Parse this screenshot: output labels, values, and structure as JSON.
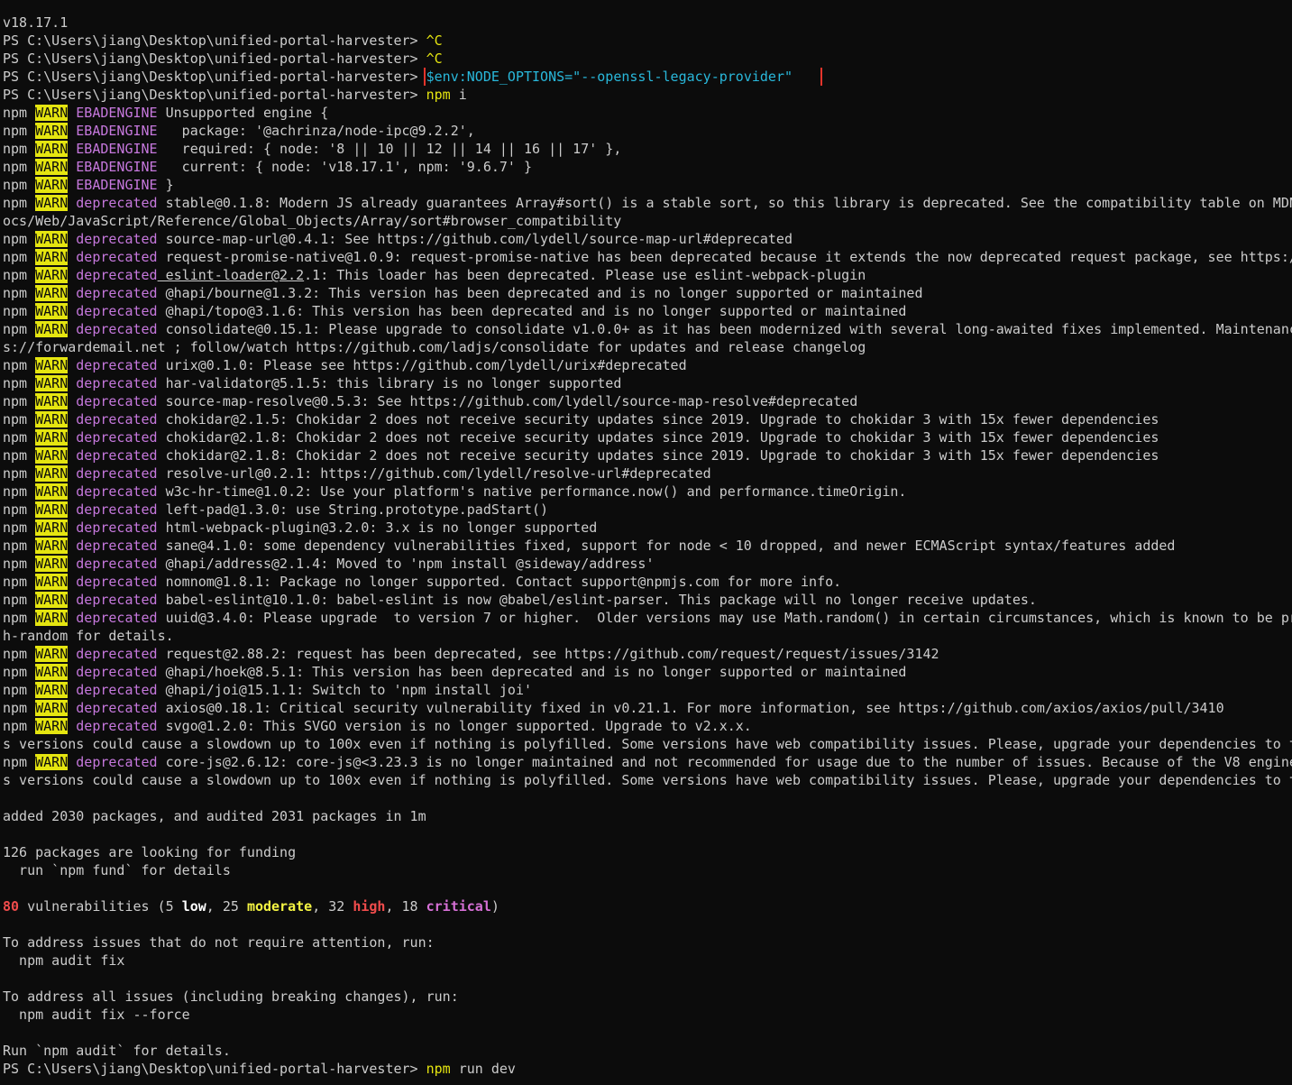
{
  "terminal": {
    "lines": [
      [
        {
          "t": "v18.17.1"
        }
      ],
      [
        {
          "t": "PS C:\\Users\\jiang\\Desktop\\unified-portal-harvester> "
        },
        {
          "t": "^C",
          "c": "yellow"
        }
      ],
      [
        {
          "t": "PS C:\\Users\\jiang\\Desktop\\unified-portal-harvester> "
        },
        {
          "t": "^C",
          "c": "yellow"
        }
      ],
      [
        {
          "t": "PS C:\\Users\\jiang\\Desktop\\unified-portal-harvester> "
        },
        {
          "t": "$env:NODE_OPTIONS=",
          "c": "cyan boxed-start"
        },
        {
          "t": "\"--openssl-legacy-provider\"",
          "c": "cyan boxed-end"
        }
      ],
      [
        {
          "t": "PS C:\\Users\\jiang\\Desktop\\unified-portal-harvester> "
        },
        {
          "t": "npm",
          "c": "yellow"
        },
        {
          "t": " i"
        }
      ],
      [
        {
          "t": "npm "
        },
        {
          "t": "WARN",
          "c": "warn"
        },
        {
          "t": " "
        },
        {
          "t": "EBADENGINE",
          "c": "magenta"
        },
        {
          "t": " Unsupported engine {"
        }
      ],
      [
        {
          "t": "npm "
        },
        {
          "t": "WARN",
          "c": "warn"
        },
        {
          "t": " "
        },
        {
          "t": "EBADENGINE",
          "c": "magenta"
        },
        {
          "t": "   package: '@achrinza/node-ipc@9.2.2',"
        }
      ],
      [
        {
          "t": "npm "
        },
        {
          "t": "WARN",
          "c": "warn"
        },
        {
          "t": " "
        },
        {
          "t": "EBADENGINE",
          "c": "magenta"
        },
        {
          "t": "   required: { node: '8 || 10 || 12 || 14 || 16 || 17' },"
        }
      ],
      [
        {
          "t": "npm "
        },
        {
          "t": "WARN",
          "c": "warn"
        },
        {
          "t": " "
        },
        {
          "t": "EBADENGINE",
          "c": "magenta"
        },
        {
          "t": "   current: { node: 'v18.17.1', npm: '9.6.7' }"
        }
      ],
      [
        {
          "t": "npm "
        },
        {
          "t": "WARN",
          "c": "warn"
        },
        {
          "t": " "
        },
        {
          "t": "EBADENGINE",
          "c": "magenta"
        },
        {
          "t": " }"
        }
      ],
      [
        {
          "t": "npm "
        },
        {
          "t": "WARN",
          "c": "warn"
        },
        {
          "t": " "
        },
        {
          "t": "deprecated",
          "c": "magenta"
        },
        {
          "t": " stable@0.1.8: Modern JS already guarantees Array#sort() is a stable sort, so this library is deprecated. See the compatibility table on MDN"
        }
      ],
      [
        {
          "t": "ocs/Web/JavaScript/Reference/Global_Objects/Array/sort#browser_compatibility"
        }
      ],
      [
        {
          "t": "npm "
        },
        {
          "t": "WARN",
          "c": "warn"
        },
        {
          "t": " "
        },
        {
          "t": "deprecated",
          "c": "magenta"
        },
        {
          "t": " source-map-url@0.4.1: See https://github.com/lydell/source-map-url#deprecated"
        }
      ],
      [
        {
          "t": "npm "
        },
        {
          "t": "WARN",
          "c": "warn"
        },
        {
          "t": " "
        },
        {
          "t": "deprecated",
          "c": "magenta"
        },
        {
          "t": " request-promise-native@1.0.9: request-promise-native has been deprecated because it extends the now deprecated request package, see https:/"
        }
      ],
      [
        {
          "t": "npm "
        },
        {
          "t": "WARN",
          "c": "warn"
        },
        {
          "t": " "
        },
        {
          "t": "deprecated",
          "c": "magenta"
        },
        {
          "t": " eslint-loader@2.2",
          "c": "underline"
        },
        {
          "t": ".1: This loader has been deprecated. Please use eslint-webpack-plugin"
        }
      ],
      [
        {
          "t": "npm "
        },
        {
          "t": "WARN",
          "c": "warn"
        },
        {
          "t": " "
        },
        {
          "t": "deprecated",
          "c": "magenta"
        },
        {
          "t": " @hapi/bourne@1.3.2: This version has been deprecated and is no longer supported or maintained"
        }
      ],
      [
        {
          "t": "npm "
        },
        {
          "t": "WARN",
          "c": "warn"
        },
        {
          "t": " "
        },
        {
          "t": "deprecated",
          "c": "magenta"
        },
        {
          "t": " @hapi/topo@3.1.6: This version has been deprecated and is no longer supported or maintained"
        }
      ],
      [
        {
          "t": "npm "
        },
        {
          "t": "WARN",
          "c": "warn"
        },
        {
          "t": " "
        },
        {
          "t": "deprecated",
          "c": "magenta"
        },
        {
          "t": " consolidate@0.15.1: Please upgrade to consolidate v1.0.0+ as it has been modernized with several long-awaited fixes implemented. Maintenanc"
        }
      ],
      [
        {
          "t": "s://forwardemail.net ; follow/watch https://github.com/ladjs/consolidate for updates and release changelog"
        }
      ],
      [
        {
          "t": "npm "
        },
        {
          "t": "WARN",
          "c": "warn"
        },
        {
          "t": " "
        },
        {
          "t": "deprecated",
          "c": "magenta"
        },
        {
          "t": " urix@0.1.0: Please see https://github.com/lydell/urix#deprecated"
        }
      ],
      [
        {
          "t": "npm "
        },
        {
          "t": "WARN",
          "c": "warn"
        },
        {
          "t": " "
        },
        {
          "t": "deprecated",
          "c": "magenta"
        },
        {
          "t": " har-validator@5.1.5: this library is no longer supported"
        }
      ],
      [
        {
          "t": "npm "
        },
        {
          "t": "WARN",
          "c": "warn"
        },
        {
          "t": " "
        },
        {
          "t": "deprecated",
          "c": "magenta"
        },
        {
          "t": " source-map-resolve@0.5.3: See https://github.com/lydell/source-map-resolve#deprecated"
        }
      ],
      [
        {
          "t": "npm "
        },
        {
          "t": "WARN",
          "c": "warn"
        },
        {
          "t": " "
        },
        {
          "t": "deprecated",
          "c": "magenta"
        },
        {
          "t": " chokidar@2.1.5: Chokidar 2 does not receive security updates since 2019. Upgrade to chokidar 3 with 15x fewer dependencies"
        }
      ],
      [
        {
          "t": "npm "
        },
        {
          "t": "WARN",
          "c": "warn"
        },
        {
          "t": " "
        },
        {
          "t": "deprecated",
          "c": "magenta"
        },
        {
          "t": " chokidar@2.1.8: Chokidar 2 does not receive security updates since 2019. Upgrade to chokidar 3 with 15x fewer dependencies"
        }
      ],
      [
        {
          "t": "npm "
        },
        {
          "t": "WARN",
          "c": "warn"
        },
        {
          "t": " "
        },
        {
          "t": "deprecated",
          "c": "magenta"
        },
        {
          "t": " chokidar@2.1.8: Chokidar 2 does not receive security updates since 2019. Upgrade to chokidar 3 with 15x fewer dependencies"
        }
      ],
      [
        {
          "t": "npm "
        },
        {
          "t": "WARN",
          "c": "warn"
        },
        {
          "t": " "
        },
        {
          "t": "deprecated",
          "c": "magenta"
        },
        {
          "t": " resolve-url@0.2.1: https://github.com/lydell/resolve-url#deprecated"
        }
      ],
      [
        {
          "t": "npm "
        },
        {
          "t": "WARN",
          "c": "warn"
        },
        {
          "t": " "
        },
        {
          "t": "deprecated",
          "c": "magenta"
        },
        {
          "t": " w3c-hr-time@1.0.2: Use your platform's native performance.now() and performance.timeOrigin."
        }
      ],
      [
        {
          "t": "npm "
        },
        {
          "t": "WARN",
          "c": "warn"
        },
        {
          "t": " "
        },
        {
          "t": "deprecated",
          "c": "magenta"
        },
        {
          "t": " left-pad@1.3.0: use String.prototype.padStart()"
        }
      ],
      [
        {
          "t": "npm "
        },
        {
          "t": "WARN",
          "c": "warn"
        },
        {
          "t": " "
        },
        {
          "t": "deprecated",
          "c": "magenta"
        },
        {
          "t": " html-webpack-plugin@3.2.0: 3.x is no longer supported"
        }
      ],
      [
        {
          "t": "npm "
        },
        {
          "t": "WARN",
          "c": "warn"
        },
        {
          "t": " "
        },
        {
          "t": "deprecated",
          "c": "magenta"
        },
        {
          "t": " sane@4.1.0: some dependency vulnerabilities fixed, support for node < 10 dropped, and newer ECMAScript syntax/features added"
        }
      ],
      [
        {
          "t": "npm "
        },
        {
          "t": "WARN",
          "c": "warn"
        },
        {
          "t": " "
        },
        {
          "t": "deprecated",
          "c": "magenta"
        },
        {
          "t": " @hapi/address@2.1.4: Moved to 'npm install @sideway/address'"
        }
      ],
      [
        {
          "t": "npm "
        },
        {
          "t": "WARN",
          "c": "warn"
        },
        {
          "t": " "
        },
        {
          "t": "deprecated",
          "c": "magenta"
        },
        {
          "t": " nomnom@1.8.1: Package no longer supported. Contact support@npmjs.com for more info."
        }
      ],
      [
        {
          "t": "npm "
        },
        {
          "t": "WARN",
          "c": "warn"
        },
        {
          "t": " "
        },
        {
          "t": "deprecated",
          "c": "magenta"
        },
        {
          "t": " babel-eslint@10.1.0: babel-eslint is now @babel/eslint-parser. This package will no longer receive updates."
        }
      ],
      [
        {
          "t": "npm "
        },
        {
          "t": "WARN",
          "c": "warn"
        },
        {
          "t": " "
        },
        {
          "t": "deprecated",
          "c": "magenta"
        },
        {
          "t": " uuid@3.4.0: Please upgrade  to version 7 or higher.  Older versions may use Math.random() in certain circumstances, which is known to be pr"
        }
      ],
      [
        {
          "t": "h-random for details."
        }
      ],
      [
        {
          "t": "npm "
        },
        {
          "t": "WARN",
          "c": "warn"
        },
        {
          "t": " "
        },
        {
          "t": "deprecated",
          "c": "magenta"
        },
        {
          "t": " request@2.88.2: request has been deprecated, see https://github.com/request/request/issues/3142"
        }
      ],
      [
        {
          "t": "npm "
        },
        {
          "t": "WARN",
          "c": "warn"
        },
        {
          "t": " "
        },
        {
          "t": "deprecated",
          "c": "magenta"
        },
        {
          "t": " @hapi/hoek@8.5.1: This version has been deprecated and is no longer supported or maintained"
        }
      ],
      [
        {
          "t": "npm "
        },
        {
          "t": "WARN",
          "c": "warn"
        },
        {
          "t": " "
        },
        {
          "t": "deprecated",
          "c": "magenta"
        },
        {
          "t": " @hapi/joi@15.1.1: Switch to 'npm install joi'"
        }
      ],
      [
        {
          "t": "npm "
        },
        {
          "t": "WARN",
          "c": "warn"
        },
        {
          "t": " "
        },
        {
          "t": "deprecated",
          "c": "magenta"
        },
        {
          "t": " axios@0.18.1: Critical security vulnerability fixed in v0.21.1. For more information, see https://github.com/axios/axios/pull/3410"
        }
      ],
      [
        {
          "t": "npm "
        },
        {
          "t": "WARN",
          "c": "warn"
        },
        {
          "t": " "
        },
        {
          "t": "deprecated",
          "c": "magenta"
        },
        {
          "t": " svgo@1.2.0: This SVGO version is no longer supported. Upgrade to v2.x.x."
        }
      ],
      [
        {
          "t": "s versions could cause a slowdown up to 100x even if nothing is polyfilled. Some versions have web compatibility issues. Please, upgrade your dependencies to t"
        }
      ],
      [
        {
          "t": "npm "
        },
        {
          "t": "WARN",
          "c": "warn"
        },
        {
          "t": " "
        },
        {
          "t": "deprecated",
          "c": "magenta"
        },
        {
          "t": " core-js@2.6.12: core-js@<3.23.3 is no longer maintained and not recommended for usage due to the number of issues. Because of the V8 engine"
        }
      ],
      [
        {
          "t": "s versions could cause a slowdown up to 100x even if nothing is polyfilled. Some versions have web compatibility issues. Please, upgrade your dependencies to t"
        }
      ],
      [],
      [
        {
          "t": "added 2030 packages, and audited 2031 packages in 1m"
        }
      ],
      [],
      [
        {
          "t": "126 packages are looking for funding"
        }
      ],
      [
        {
          "t": "  run `npm fund` for details"
        }
      ],
      [],
      [
        {
          "t": "80",
          "c": "red"
        },
        {
          "t": " vulnerabilities (5 "
        },
        {
          "t": "low",
          "c": "boldwhite"
        },
        {
          "t": ", 25 "
        },
        {
          "t": "moderate",
          "c": "boldyellow"
        },
        {
          "t": ", 32 "
        },
        {
          "t": "high",
          "c": "red"
        },
        {
          "t": ", 18 "
        },
        {
          "t": "critical",
          "c": "boldmagenta"
        },
        {
          "t": ")"
        }
      ],
      [],
      [
        {
          "t": "To address issues that do not require attention, run:"
        }
      ],
      [
        {
          "t": "  npm audit fix"
        }
      ],
      [],
      [
        {
          "t": "To address all issues (including breaking changes), run:"
        }
      ],
      [
        {
          "t": "  npm audit fix --force"
        }
      ],
      [],
      [
        {
          "t": "Run `npm audit` for details."
        }
      ],
      [
        {
          "t": "PS C:\\Users\\jiang\\Desktop\\unified-portal-harvester> "
        },
        {
          "t": "npm",
          "c": "yellow"
        },
        {
          "t": " run dev"
        }
      ]
    ]
  },
  "colors": {
    "background": "#0c0c0c",
    "foreground": "#cccccc",
    "warn_bg": "#e5e510",
    "magenta": "#c678dd",
    "cyan": "#29b8db",
    "highlight_box": "#e5342b"
  }
}
